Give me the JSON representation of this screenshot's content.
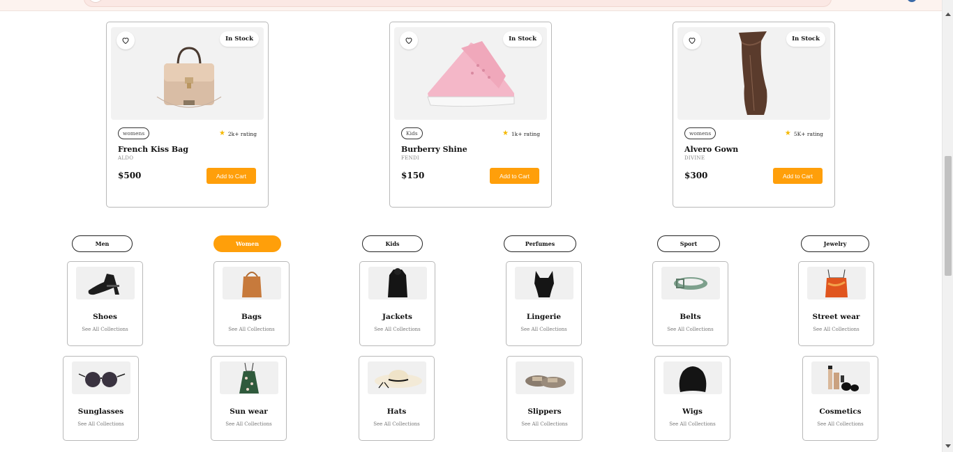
{
  "products": [
    {
      "stock": "In Stock",
      "tag": "womens",
      "rating": "2k+ rating",
      "name": "French Kiss Bag",
      "brand": "ALDO",
      "price": "$500",
      "cart_label": "Add to Cart"
    },
    {
      "stock": "In Stock",
      "tag": "Kids",
      "rating": "1k+ rating",
      "name": "Burberry Shine",
      "brand": "FENDI",
      "price": "$150",
      "cart_label": "Add to Cart"
    },
    {
      "stock": "In Stock",
      "tag": "womens",
      "rating": "5K+ rating",
      "name": "Alvero Gown",
      "brand": "DIVINE",
      "price": "$300",
      "cart_label": "Add to Cart"
    }
  ],
  "categories": {
    "pills": [
      "Men",
      "Women",
      "Kids",
      "Perfumes",
      "Sport",
      "Jewelry"
    ],
    "active": "Women",
    "tiles": [
      {
        "title": "Shoes",
        "sub": "See All Collections"
      },
      {
        "title": "Bags",
        "sub": "See All Collections"
      },
      {
        "title": "Jackets",
        "sub": "See All Collections"
      },
      {
        "title": "Lingerie",
        "sub": "See All Collections"
      },
      {
        "title": "Belts",
        "sub": "See All Collections"
      },
      {
        "title": "Street wear",
        "sub": "See All Collections"
      },
      {
        "title": "Sunglasses",
        "sub": "See All Collections"
      },
      {
        "title": "Sun wear",
        "sub": "See All Collections"
      },
      {
        "title": "Hats",
        "sub": "See All Collections"
      },
      {
        "title": "Slippers",
        "sub": "See All Collections"
      },
      {
        "title": "Wigs",
        "sub": "See All Collections"
      },
      {
        "title": "Cosmetics",
        "sub": "See All Collections"
      }
    ]
  },
  "colors": {
    "accent": "#ff9f0a",
    "star": "#f5b800",
    "image_bg": "#f2f2f2"
  },
  "icons": [
    "heart-icon",
    "star-icon",
    "scroll-up-arrow",
    "scroll-down-arrow"
  ]
}
